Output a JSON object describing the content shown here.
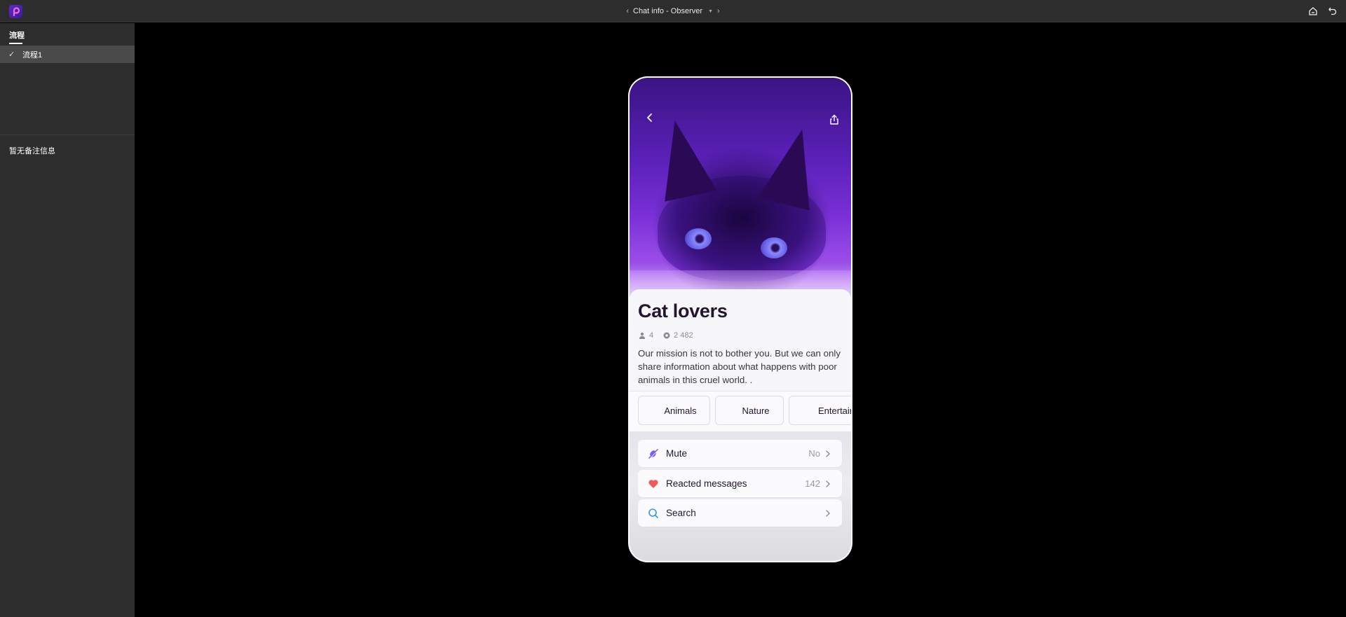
{
  "topbar": {
    "title": "Chat info - Observer",
    "prev_icon": "chevron-left-icon",
    "next_icon": "chevron-right-icon",
    "dropdown_icon": "caret-down-icon",
    "logo_icon": "app-logo-icon",
    "actions": [
      {
        "name": "home",
        "icon": "home-icon"
      },
      {
        "name": "undo",
        "icon": "undo-icon"
      }
    ]
  },
  "sidebar": {
    "tab_label": "流程",
    "items": [
      {
        "label": "流程1",
        "checked": true
      }
    ],
    "note": "暂无备注信息"
  },
  "phone": {
    "hero": {
      "back_icon": "chevron-left-icon",
      "share_icon": "share-icon",
      "image": "purple-cat-photo"
    },
    "group": {
      "title": "Cat lovers",
      "members_count": "4",
      "views_count": "2 482",
      "description": "Our mission is not to bother you. But we can only share information about what happens with poor animals in this cruel world.        ."
    },
    "tags": [
      "Animals",
      "Nature",
      "Entertainment"
    ],
    "settings": [
      {
        "label": "Mute",
        "value": "No",
        "icon": "mute-icon",
        "color": "#7b5cf0"
      },
      {
        "label": "Reacted messages",
        "value": "142",
        "icon": "heart-icon",
        "color": "#f05a5a"
      },
      {
        "label": "Search",
        "value": "",
        "icon": "search-icon",
        "color": "#2b9af3"
      }
    ]
  }
}
